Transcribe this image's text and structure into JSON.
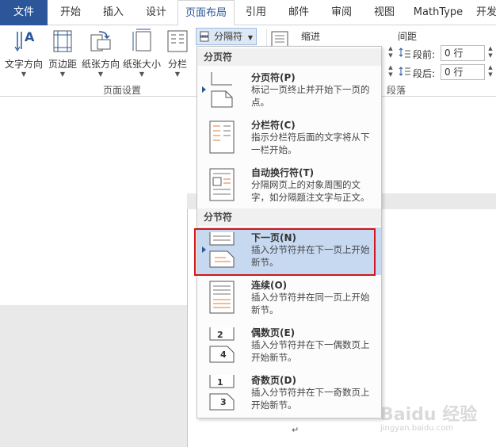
{
  "tabs": [
    {
      "label": "文件"
    },
    {
      "label": "开始"
    },
    {
      "label": "插入"
    },
    {
      "label": "设计"
    },
    {
      "label": "页面布局"
    },
    {
      "label": "引用"
    },
    {
      "label": "邮件"
    },
    {
      "label": "审阅"
    },
    {
      "label": "视图"
    },
    {
      "label": "MathType"
    },
    {
      "label": "开发"
    }
  ],
  "ribbon": {
    "text_direction": "文字方向",
    "margins": "页边距",
    "orientation": "纸张方向",
    "size": "纸张大小",
    "columns": "分栏",
    "breaks_button": "分隔符",
    "page_setup_group": "页面设置",
    "indent_label": "缩进",
    "spacing_label": "间距",
    "before_label": "段前:",
    "before_value": "0 行",
    "after_label": "段后:",
    "after_value": "0 行",
    "paragraph_group": "段落"
  },
  "menu": {
    "page_breaks_header": "分页符",
    "section_breaks_header": "分节符",
    "items": [
      {
        "title": "分页符(P)",
        "desc": "标记一页终止并开始下一页的点。"
      },
      {
        "title": "分栏符(C)",
        "desc": "指示分栏符后面的文字将从下一栏开始。"
      },
      {
        "title": "自动换行符(T)",
        "desc": "分隔网页上的对象周围的文字，如分隔题注文字与正文。"
      },
      {
        "title": "下一页(N)",
        "desc": "插入分节符并在下一页上开始新节。"
      },
      {
        "title": "连续(O)",
        "desc": "插入分节符并在同一页上开始新节。"
      },
      {
        "title": "偶数页(E)",
        "desc": "插入分节符并在下一偶数页上开始新节。"
      },
      {
        "title": "奇数页(D)",
        "desc": "插入分节符并在下一奇数页上开始新节。"
      }
    ]
  },
  "doc": {
    "pilcrow": "↵"
  },
  "watermark": {
    "brand": "Baidu 经验",
    "url": "jingyan.baidu.com"
  },
  "colors": {
    "accent": "#2b579a",
    "highlight": "#c7d9f1",
    "callout": "#d0161a"
  }
}
